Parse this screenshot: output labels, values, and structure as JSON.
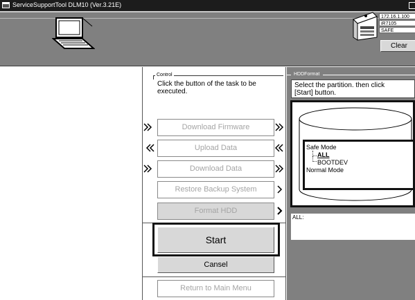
{
  "window": {
    "title": "ServiceSupportTool DLM10 (Ver.3.21E)",
    "app_icon": "window-app-icon",
    "button_icon": "maximize-icon"
  },
  "header": {
    "computer_icon": "laptop-icon",
    "device_icon": "multifunction-printer-icon",
    "device_info": [
      "172.16.1.100",
      "iR7105",
      "SAFE"
    ],
    "clear_label": "Clear"
  },
  "control": {
    "legend": "Control",
    "instruction": "Click the button of the task to be\nexecuted.",
    "tasks": [
      {
        "label": "Download Firmware",
        "enabled": false,
        "left_arrow": "double-right-arrow-icon",
        "right_arrow": "double-right-arrow-icon"
      },
      {
        "label": "Upload Data",
        "enabled": false,
        "left_arrow": "double-left-arrow-icon",
        "right_arrow": "double-left-arrow-icon"
      },
      {
        "label": "Download Data",
        "enabled": false,
        "left_arrow": "double-right-arrow-icon",
        "right_arrow": "double-right-arrow-icon"
      },
      {
        "label": "Restore Backup System",
        "enabled": false,
        "right_arrow": "right-arrow-icon"
      },
      {
        "label": "Format HDD",
        "enabled": true,
        "right_arrow": "right-arrow-icon"
      }
    ],
    "start_label": "Start",
    "cancel_label": "Cansel",
    "return_label": "Return to Main Menu"
  },
  "hdd_format": {
    "legend": "HDDFormat",
    "instruction": "Select the partition. then click\n[Start] button.",
    "disk_icon": "hard-disk-cylinder-icon",
    "tree": {
      "root_label": "Safe  Mode",
      "selected_label": "ALL",
      "child_label": "BOOTDEV",
      "sibling_label": "Normal  Mode"
    },
    "detail_text": "ALL:"
  },
  "colors": {
    "titlebar": "#1c1c1c",
    "panel_gray": "#808080",
    "button_gray": "#d8d8d8",
    "disabled_text": "#a4a4a4"
  }
}
